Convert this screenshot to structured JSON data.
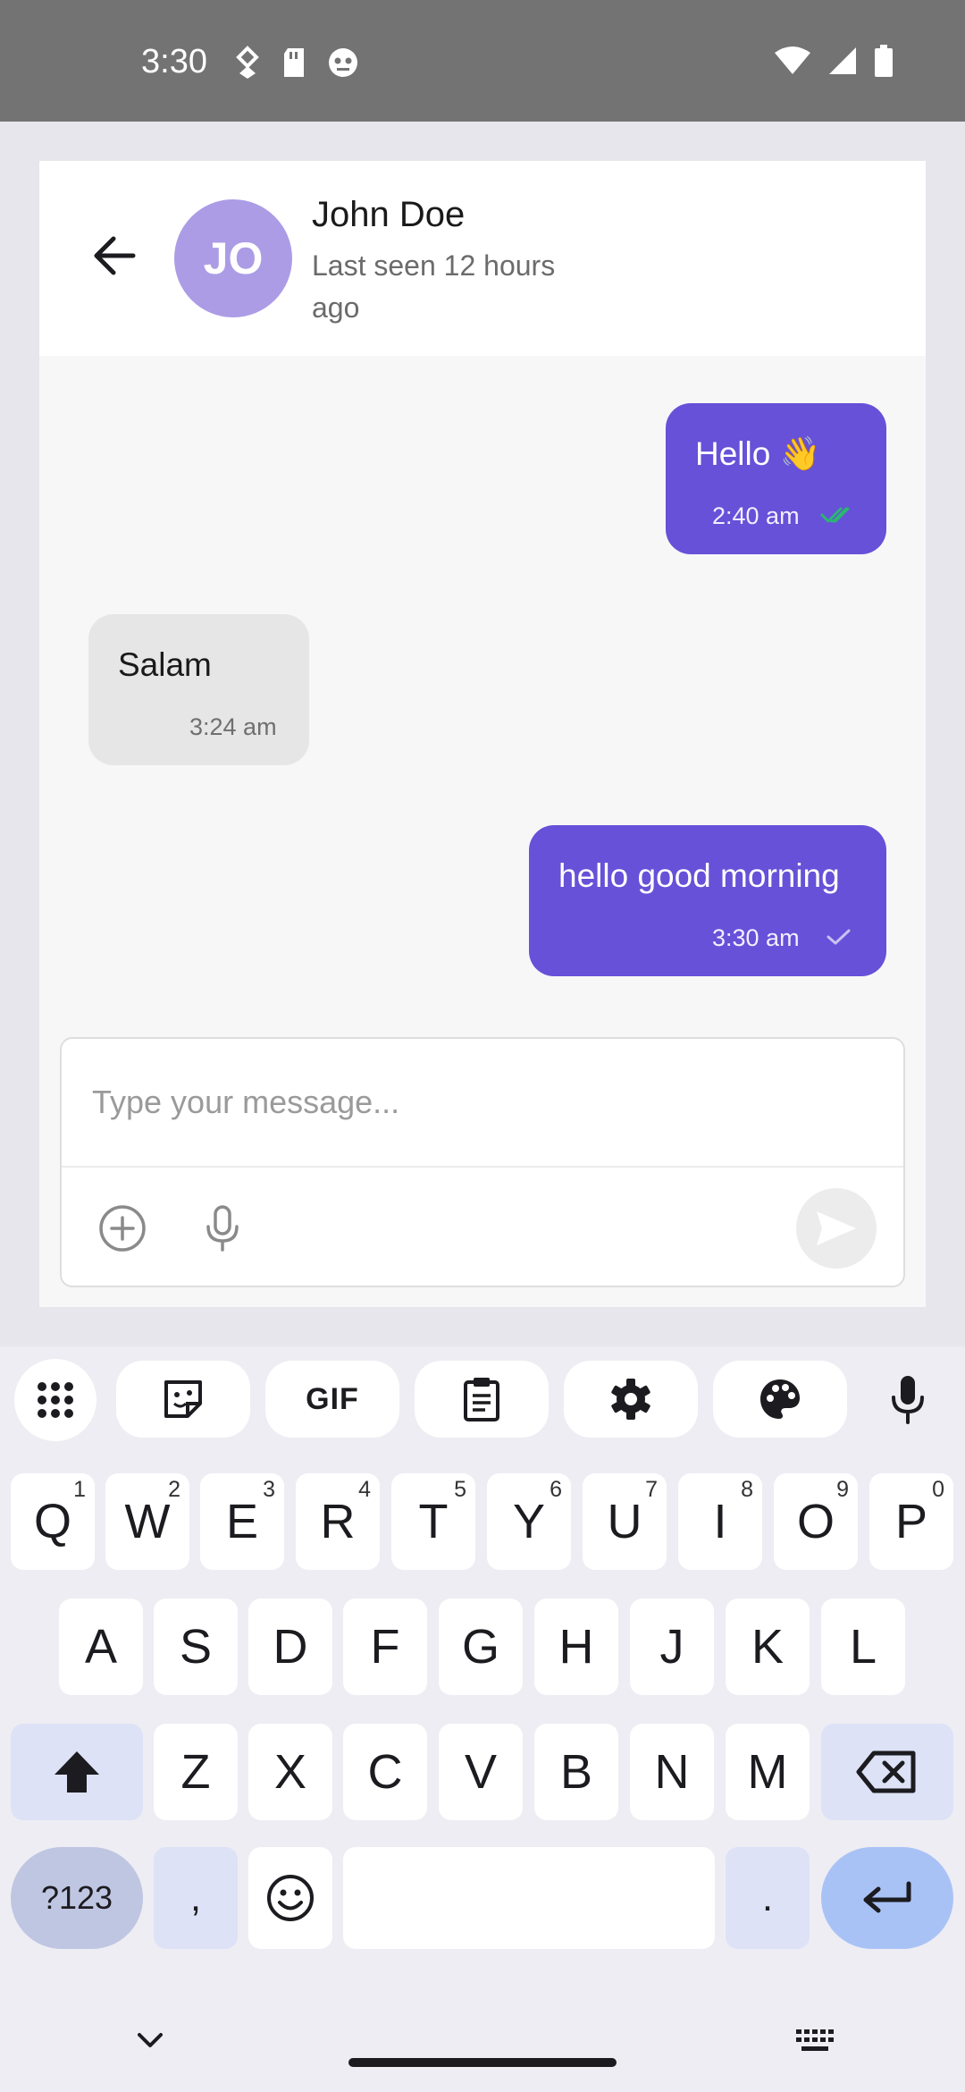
{
  "status_bar": {
    "time": "3:30",
    "left_icons": [
      "data-saver-icon",
      "sd-card-icon",
      "robot-face-icon"
    ],
    "right_icons": [
      "wifi-icon",
      "signal-icon",
      "battery-icon"
    ]
  },
  "chat": {
    "contact": {
      "initials": "JO",
      "name": "John Doe",
      "last_seen_line1": "Last seen 12 hours",
      "last_seen_line2": "ago",
      "avatar_color": "#ac9ce6"
    },
    "messages": [
      {
        "direction": "outgoing",
        "text": "Hello 👋",
        "time": "2:40 am",
        "status": "read"
      },
      {
        "direction": "incoming",
        "text": "Salam",
        "time": "3:24 am"
      },
      {
        "direction": "outgoing",
        "text": "hello good morning",
        "time": "3:30 am",
        "status": "sent"
      }
    ],
    "composer": {
      "placeholder": "Type your message...",
      "value": ""
    },
    "colors": {
      "outgoing_bubble": "#6651d8",
      "incoming_bubble": "#e6e6e6",
      "read_tick": "#2bb673"
    }
  },
  "keyboard": {
    "toolbar_icons": [
      "apps-grid-icon",
      "sticker-icon",
      "gif-icon",
      "clipboard-icon",
      "settings-icon",
      "palette-icon",
      "mic-icon"
    ],
    "gif_label": "GIF",
    "row1": [
      {
        "key": "Q",
        "hint": "1"
      },
      {
        "key": "W",
        "hint": "2"
      },
      {
        "key": "E",
        "hint": "3"
      },
      {
        "key": "R",
        "hint": "4"
      },
      {
        "key": "T",
        "hint": "5"
      },
      {
        "key": "Y",
        "hint": "6"
      },
      {
        "key": "U",
        "hint": "7"
      },
      {
        "key": "I",
        "hint": "8"
      },
      {
        "key": "O",
        "hint": "9"
      },
      {
        "key": "P",
        "hint": "0"
      }
    ],
    "row2": [
      "A",
      "S",
      "D",
      "F",
      "G",
      "H",
      "J",
      "K",
      "L"
    ],
    "row3": [
      "Z",
      "X",
      "C",
      "V",
      "B",
      "N",
      "M"
    ],
    "symbols_label": "?123",
    "comma_label": ",",
    "period_label": "."
  }
}
